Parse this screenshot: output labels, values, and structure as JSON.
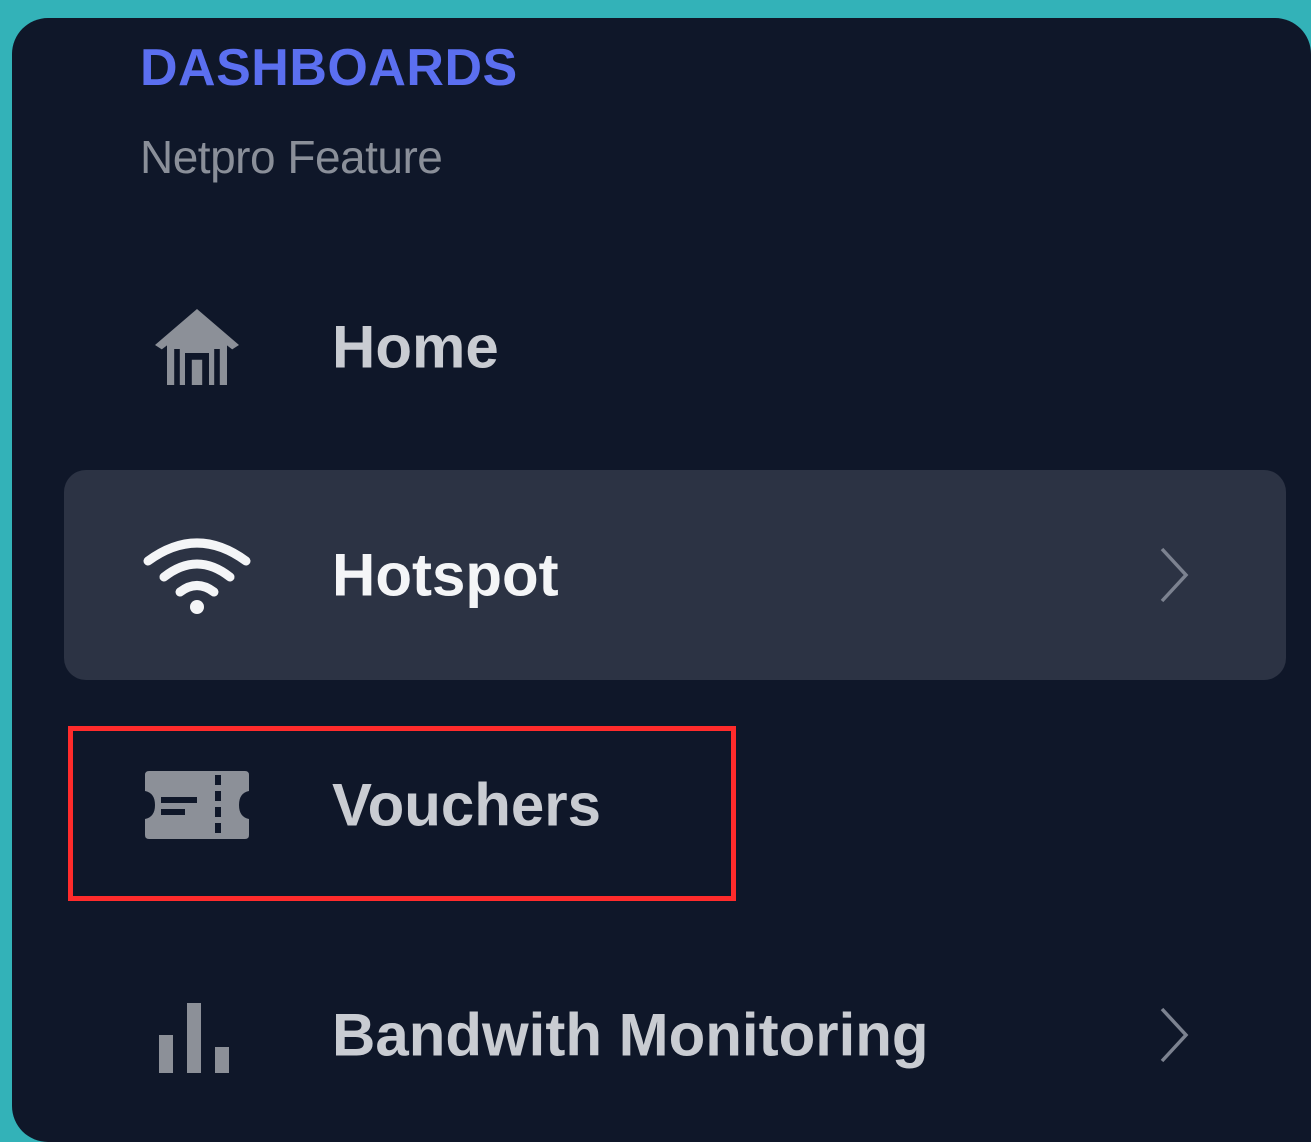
{
  "sidebar": {
    "section_title": "DASHBOARDS",
    "section_subtitle": "Netpro Feature",
    "items": [
      {
        "label": "Home",
        "icon": "home-icon",
        "active": false,
        "has_submenu": false
      },
      {
        "label": "Hotspot",
        "icon": "wifi-icon",
        "active": true,
        "has_submenu": true
      },
      {
        "label": "Vouchers",
        "icon": "ticket-icon",
        "active": false,
        "has_submenu": false,
        "highlighted": true
      },
      {
        "label": "Bandwith Monitoring",
        "icon": "bar-chart-icon",
        "active": false,
        "has_submenu": true
      }
    ]
  },
  "colors": {
    "background": "#33b2b8",
    "panel": "#0f1729",
    "accent": "#5b6ff0",
    "active_item": "#2c3344",
    "highlight": "#ff2b2b",
    "text": "#c9ccd2",
    "muted": "#8a8f99"
  }
}
